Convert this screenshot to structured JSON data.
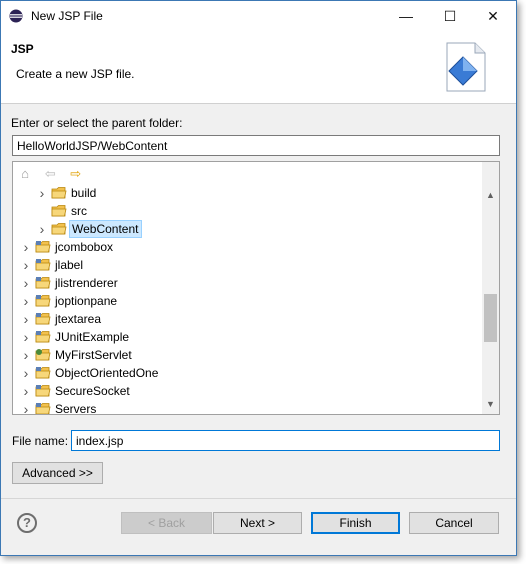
{
  "window": {
    "title": "New JSP File",
    "minimize_glyph": "—",
    "maximize_glyph": "☐",
    "close_glyph": "✕"
  },
  "header": {
    "title": "JSP",
    "description": "Create a new JSP file."
  },
  "folder": {
    "label": "Enter or select the parent folder:",
    "value": "HelloWorldJSP/WebContent"
  },
  "tree": {
    "toolbar": [
      "home-icon",
      "back-icon",
      "forward-icon"
    ],
    "items": [
      {
        "label": "build",
        "expandable": true,
        "indent": 1,
        "icon": "folder"
      },
      {
        "label": "src",
        "expandable": false,
        "indent": 1,
        "icon": "folder"
      },
      {
        "label": "WebContent",
        "expandable": true,
        "indent": 1,
        "icon": "folder",
        "selected": true
      },
      {
        "label": "jcombobox",
        "expandable": true,
        "indent": 0,
        "icon": "project"
      },
      {
        "label": "jlabel",
        "expandable": true,
        "indent": 0,
        "icon": "project"
      },
      {
        "label": "jlistrenderer",
        "expandable": true,
        "indent": 0,
        "icon": "project"
      },
      {
        "label": "joptionpane",
        "expandable": true,
        "indent": 0,
        "icon": "project"
      },
      {
        "label": "jtextarea",
        "expandable": true,
        "indent": 0,
        "icon": "project"
      },
      {
        "label": "JUnitExample",
        "expandable": true,
        "indent": 0,
        "icon": "project"
      },
      {
        "label": "MyFirstServlet",
        "expandable": true,
        "indent": 0,
        "icon": "web-project"
      },
      {
        "label": "ObjectOrientedOne",
        "expandable": true,
        "indent": 0,
        "icon": "project"
      },
      {
        "label": "SecureSocket",
        "expandable": true,
        "indent": 0,
        "icon": "project"
      },
      {
        "label": "Servers",
        "expandable": true,
        "indent": 0,
        "icon": "project"
      }
    ]
  },
  "filename": {
    "label": "File name:",
    "value": "index.jsp"
  },
  "buttons": {
    "advanced": "Advanced >>",
    "back": "< Back",
    "next": "Next >",
    "finish": "Finish",
    "cancel": "Cancel",
    "help": "?"
  }
}
